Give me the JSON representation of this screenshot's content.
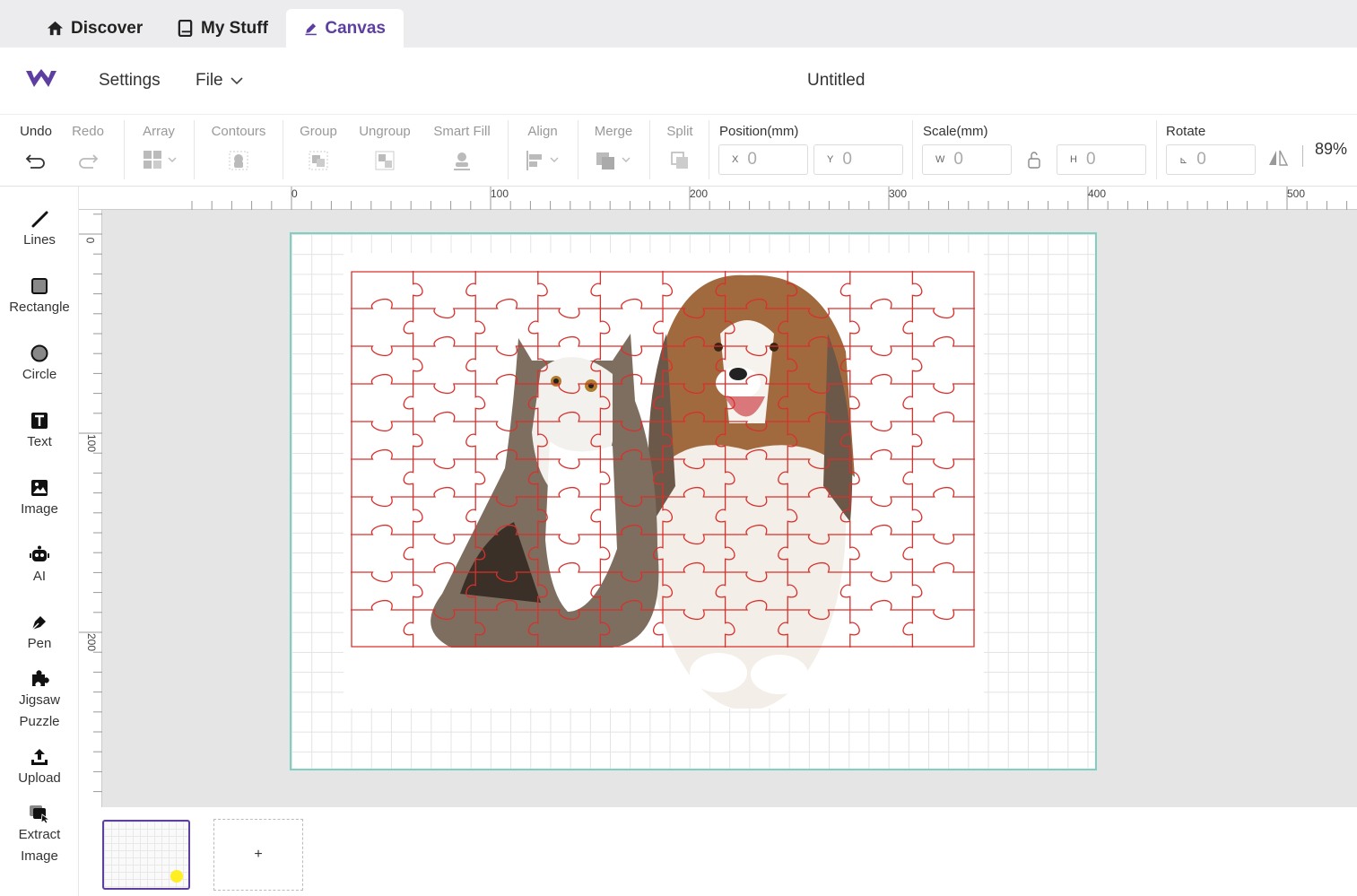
{
  "tabs": [
    {
      "label": "Discover",
      "icon": "home-icon"
    },
    {
      "label": "My Stuff",
      "icon": "book-icon"
    },
    {
      "label": "Canvas",
      "icon": "pencil-icon",
      "active": true
    }
  ],
  "header": {
    "settings": "Settings",
    "file": "File",
    "title": "Untitled"
  },
  "toolbar": {
    "undo": "Undo",
    "redo": "Redo",
    "array": "Array",
    "contours": "Contours",
    "group": "Group",
    "ungroup": "Ungroup",
    "smart_fill": "Smart Fill",
    "align": "Align",
    "merge": "Merge",
    "split": "Split",
    "position_label": "Position(mm)",
    "x_prefix": "X",
    "x_value": "0",
    "y_prefix": "Y",
    "y_value": "0",
    "scale_label": "Scale(mm)",
    "w_prefix": "W",
    "w_value": "0",
    "h_prefix": "H",
    "h_value": "0",
    "rotate_label": "Rotate",
    "rotate_prefix": "⊾",
    "rotate_value": "0",
    "zoom": "89%"
  },
  "sidebar": [
    {
      "label": "Lines",
      "icon": "line-icon"
    },
    {
      "label": "Rectangle",
      "icon": "rectangle-icon"
    },
    {
      "label": "Circle",
      "icon": "circle-icon"
    },
    {
      "label": "Text",
      "icon": "text-icon"
    },
    {
      "label": "Image",
      "icon": "image-icon"
    },
    {
      "label": "AI",
      "icon": "robot-icon"
    },
    {
      "label": "Pen",
      "icon": "pen-icon"
    },
    {
      "label": "Jigsaw Puzzle",
      "icon": "puzzle-icon"
    },
    {
      "label": "Upload",
      "icon": "upload-icon"
    },
    {
      "label": "Extract Image",
      "icon": "extract-image-icon"
    }
  ],
  "ruler": {
    "top": [
      "0",
      "100",
      "200",
      "300",
      "400",
      "500"
    ],
    "left": [
      "0",
      "100",
      "200"
    ]
  },
  "pages": {
    "add": "+"
  },
  "colors": {
    "accent": "#5c3fa0",
    "board_border": "#7fd0c0",
    "puzzle_line": "#d9302c"
  }
}
